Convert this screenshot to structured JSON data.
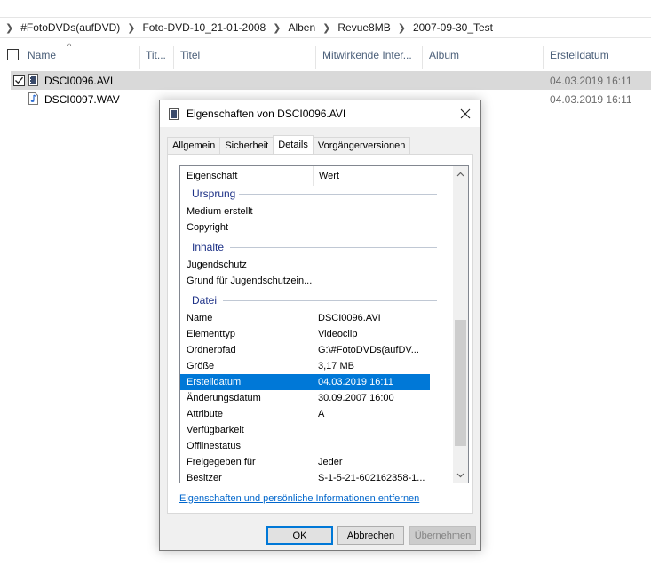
{
  "explorer": {
    "breadcrumb": [
      "#FotoDVDs(aufDVD)",
      "Foto-DVD-10_21-01-2008",
      "Alben",
      "Revue8MB",
      "2007-09-30_Test"
    ],
    "columns": {
      "name": "Name",
      "tit_short": "Tit...",
      "titel": "Titel",
      "mitwirkende": "Mitwirkende Inter...",
      "album": "Album",
      "erstelldatum": "Erstelldatum"
    },
    "files": [
      {
        "name": "DSCI0096.AVI",
        "date": "04.03.2019 16:11",
        "icon": "video-file-icon",
        "selected": true
      },
      {
        "name": "DSCI0097.WAV",
        "date": "04.03.2019 16:11",
        "icon": "audio-file-icon",
        "selected": false
      }
    ]
  },
  "dialog": {
    "title": "Eigenschaften von DSCI0096.AVI",
    "tabs": [
      "Allgemein",
      "Sicherheit",
      "Details",
      "Vorgängerversionen"
    ],
    "active_tab": "Details",
    "list_header": {
      "property": "Eigenschaft",
      "value": "Wert"
    },
    "groups": {
      "ursprung": "Ursprung",
      "inhalte": "Inhalte",
      "datei": "Datei"
    },
    "ursprung_rows": [
      {
        "k": "Medium erstellt",
        "v": ""
      },
      {
        "k": "Copyright",
        "v": ""
      }
    ],
    "inhalte_rows": [
      {
        "k": "Jugendschutz",
        "v": ""
      },
      {
        "k": "Grund für Jugendschutzein...",
        "v": ""
      }
    ],
    "datei_rows": [
      {
        "k": "Name",
        "v": "DSCI0096.AVI"
      },
      {
        "k": "Elementtyp",
        "v": "Videoclip"
      },
      {
        "k": "Ordnerpfad",
        "v": "G:\\#FotoDVDs(aufDV..."
      },
      {
        "k": "Größe",
        "v": "3,17 MB"
      },
      {
        "k": "Erstelldatum",
        "v": "04.03.2019 16:11"
      },
      {
        "k": "Änderungsdatum",
        "v": "30.09.2007 16:00"
      },
      {
        "k": "Attribute",
        "v": "A"
      },
      {
        "k": "Verfügbarkeit",
        "v": ""
      },
      {
        "k": "Offlinestatus",
        "v": ""
      },
      {
        "k": "Freigegeben für",
        "v": "Jeder"
      },
      {
        "k": "Besitzer",
        "v": "S-1-5-21-602162358-1..."
      }
    ],
    "selected_row": "Erstelldatum",
    "remove_link": "Eigenschaften und persönliche Informationen entfernen",
    "buttons": {
      "ok": "OK",
      "cancel": "Abbrechen",
      "apply": "Übernehmen"
    }
  },
  "colors": {
    "accent": "#0078d7",
    "group_text": "#1e3287",
    "link": "#0066cc"
  }
}
